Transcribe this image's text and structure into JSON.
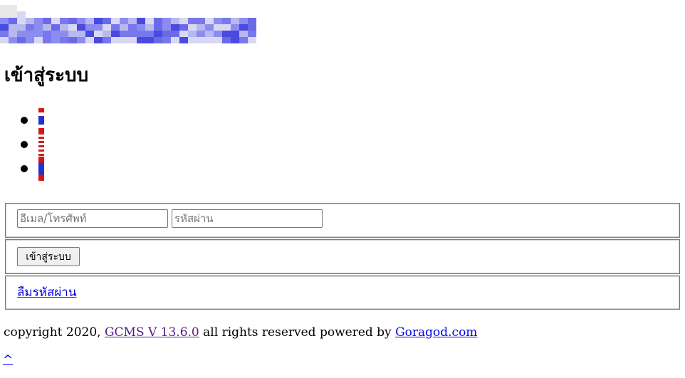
{
  "header": {
    "logo_icon": "pixelated-site-logo",
    "logo_colors": [
      "#e8e8e8",
      "#d8d8f4",
      "#b8b8f0",
      "#8c8cf0",
      "#6a6ae8",
      "#4a4ae0",
      "#7878ec"
    ]
  },
  "page": {
    "title": "เข้าสู่ระบบ"
  },
  "languages": [
    {
      "icon": "flag-th-icon"
    },
    {
      "icon": "flag-en-icon"
    },
    {
      "icon": "flag-la-icon"
    }
  ],
  "form": {
    "email_placeholder": "อีเมล/โทรศัพท์",
    "email_value": "",
    "password_placeholder": "รหัสผ่าน",
    "password_value": "",
    "submit_label": "เข้าสู่ระบบ",
    "forgot_label": "ลืมรหัสผ่าน"
  },
  "footer": {
    "prefix": "copyright 2020, ",
    "gcms_label": "GCMS V 13.6.0",
    "middle": " all rights reserved powered by ",
    "goragod_label": "Goragod.com"
  },
  "back_to_top": "^"
}
